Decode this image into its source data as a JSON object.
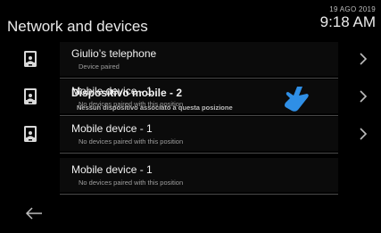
{
  "header": {
    "title": "Network and devices",
    "date": "19 AGO 2019",
    "time": "9:18 AM"
  },
  "rows": [
    {
      "name": "Giulio’s telephone",
      "status": "Device paired",
      "chevron": true
    },
    {
      "name": "Mobile device - 1",
      "status": "No devices paired with this position",
      "chevron": true
    },
    {
      "name": "Mobile device - 1",
      "status": "No devices paired with this position",
      "chevron": true
    },
    {
      "name": "Mobile device - 1",
      "status": "No devices paired with this position",
      "chevron": false
    }
  ],
  "ghost_row": {
    "name": "Dispositivo mobile - 2",
    "status": "Nessun dispositivo associato a questa posizione"
  },
  "colors": {
    "background": "#000000",
    "row_background": "#0b0b0b",
    "accent_hand": "#2f8fe6"
  },
  "icons": [
    "phone-icon",
    "chevron-right-icon",
    "touch-hand-icon",
    "back-arrow-icon"
  ]
}
